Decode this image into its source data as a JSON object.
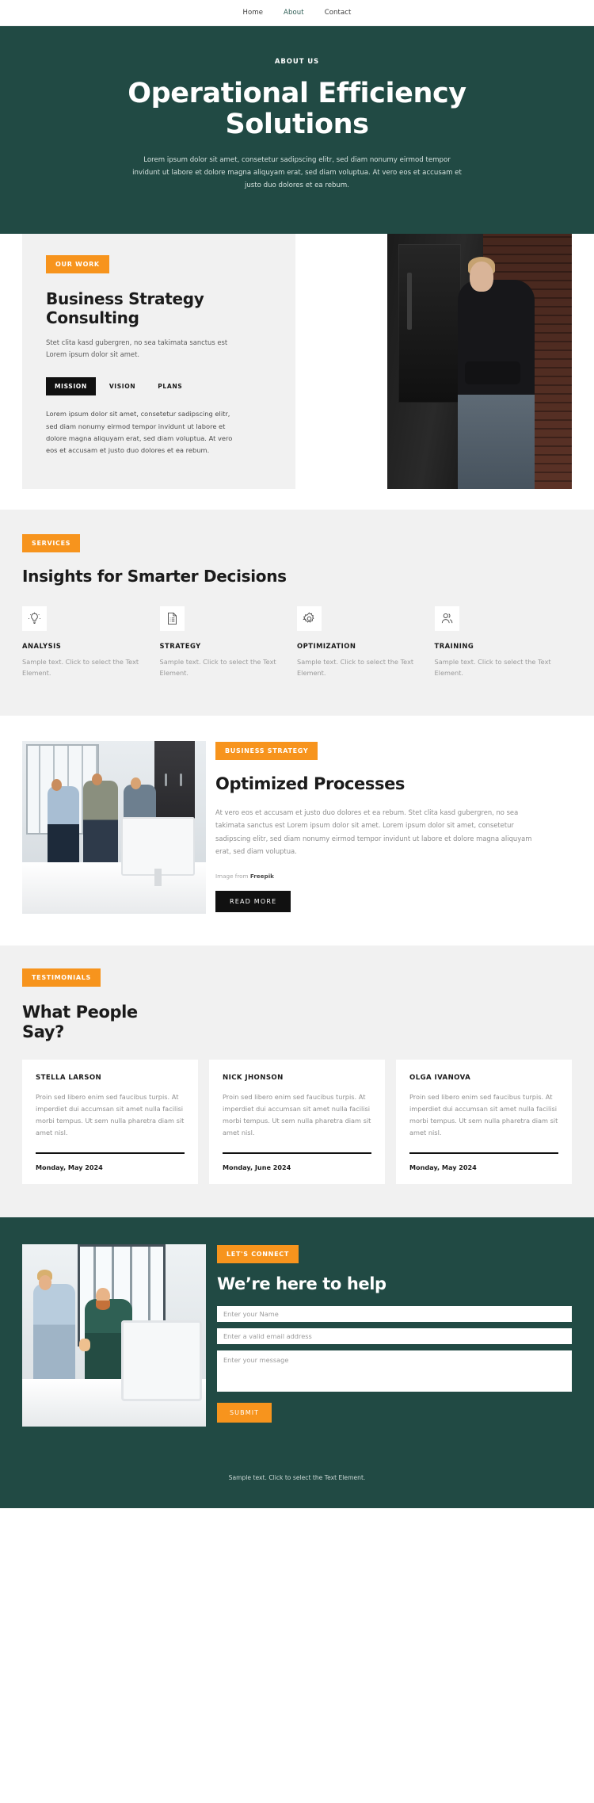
{
  "nav": {
    "items": [
      {
        "label": "Home",
        "active": false
      },
      {
        "label": "About",
        "active": true
      },
      {
        "label": "Contact",
        "active": false
      }
    ]
  },
  "hero": {
    "eyebrow": "ABOUT US",
    "title": "Operational Efficiency Solutions",
    "paragraph": "Lorem ipsum dolor sit amet, consetetur sadipscing elitr, sed diam nonumy eirmod tempor invidunt ut labore et dolore magna aliquyam erat, sed diam voluptua. At vero eos et accusam et justo duo dolores et ea rebum."
  },
  "work": {
    "badge": "OUR WORK",
    "title": "Business Strategy Consulting",
    "lead": "Stet clita kasd gubergren, no sea takimata sanctus est Lorem ipsum dolor sit amet.",
    "tabs": [
      {
        "label": "MISSION",
        "active": true
      },
      {
        "label": "VISION",
        "active": false
      },
      {
        "label": "PLANS",
        "active": false
      }
    ],
    "tab_body": "Lorem ipsum dolor sit amet, consetetur sadipscing elitr, sed diam nonumy eirmod tempor invidunt ut labore et dolore magna aliquyam erat, sed diam voluptua. At vero eos et accusam et justo duo dolores et ea rebum.",
    "photo_alt": "woman-in-black-turtleneck-brick-wall"
  },
  "services": {
    "badge": "SERVICES",
    "title": "Insights for Smarter Decisions",
    "items": [
      {
        "icon": "lightbulb-icon",
        "name": "ANALYSIS",
        "text": "Sample text. Click to select the Text Element."
      },
      {
        "icon": "document-list-icon",
        "name": "STRATEGY",
        "text": "Sample text. Click to select the Text Element."
      },
      {
        "icon": "gear-icon",
        "name": "OPTIMIZATION",
        "text": "Sample text. Click to select the Text Element."
      },
      {
        "icon": "people-icon",
        "name": "TRAINING",
        "text": "Sample text. Click to select the Text Element."
      }
    ]
  },
  "optimized": {
    "badge": "BUSINESS STRATEGY",
    "title": "Optimized Processes",
    "text": "At vero eos et accusam et justo duo dolores et ea rebum. Stet clita kasd gubergren, no sea takimata sanctus est Lorem ipsum dolor sit amet. Lorem ipsum dolor sit amet, consetetur sadipscing elitr, sed diam nonumy eirmod tempor invidunt ut labore et dolore magna aliquyam erat, sed diam voluptua.",
    "credit_prefix": "Image from ",
    "credit_source": "Freepik",
    "button": "READ MORE",
    "photo_alt": "team-meeting-in-office"
  },
  "testimonials": {
    "badge": "TESTIMONIALS",
    "title": "What People Say?",
    "cards": [
      {
        "name": "STELLA LARSON",
        "text": "Proin sed libero enim sed faucibus turpis. At imperdiet dui accumsan sit amet nulla facilisi morbi tempus. Ut sem nulla pharetra diam sit amet nisl.",
        "date": "Monday, May 2024"
      },
      {
        "name": "NICK JHONSON",
        "text": "Proin sed libero enim sed faucibus turpis. At imperdiet dui accumsan sit amet nulla facilisi morbi tempus. Ut sem nulla pharetra diam sit amet nisl.",
        "date": "Monday, June 2024"
      },
      {
        "name": "OLGA IVANOVA",
        "text": "Proin sed libero enim sed faucibus turpis. At imperdiet dui accumsan sit amet nulla facilisi morbi tempus. Ut sem nulla pharetra diam sit amet nisl.",
        "date": "Monday, May 2024"
      }
    ]
  },
  "contact": {
    "badge": "LET'S CONNECT",
    "title": "We’re here to help",
    "name_placeholder": "Enter your Name",
    "email_placeholder": "Enter a valid email address",
    "message_placeholder": "Enter your message",
    "submit": "SUBMIT",
    "photo_alt": "two-colleagues-at-desk-with-imac"
  },
  "footer": {
    "text": "Sample text. Click to select the Text Element."
  },
  "colors": {
    "brand_green": "#214a44",
    "accent_orange": "#f7941d",
    "dark": "#111111",
    "light_gray": "#f1f1f1"
  }
}
